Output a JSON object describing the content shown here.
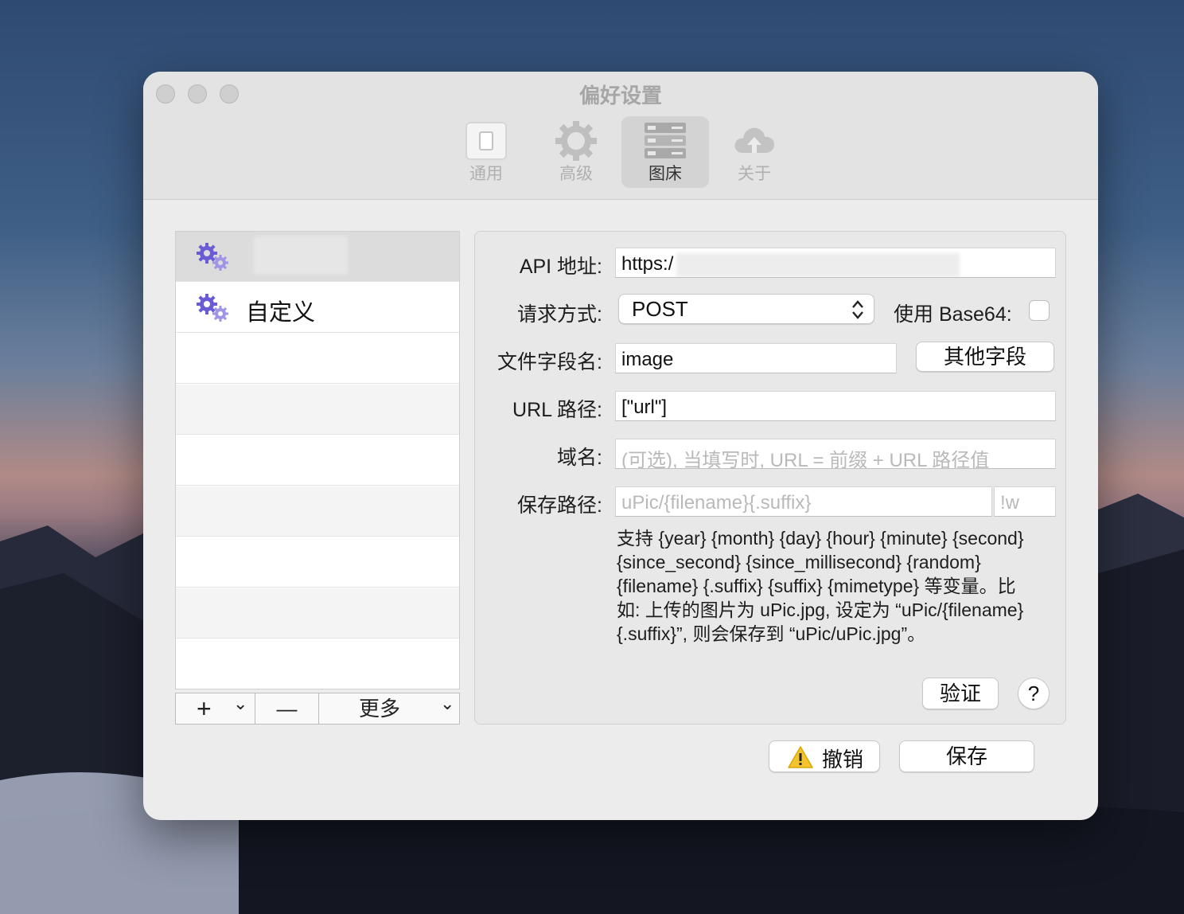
{
  "window": {
    "title": "偏好设置"
  },
  "tabs": [
    {
      "label": "通用",
      "icon": "switch-icon"
    },
    {
      "label": "高级",
      "icon": "gear-icon"
    },
    {
      "label": "图床",
      "icon": "server-icon",
      "selected": true
    },
    {
      "label": "关于",
      "icon": "cloud-upload-icon"
    }
  ],
  "hosts": [
    {
      "name": "",
      "icon": "custom-gears-icon",
      "selected": true
    },
    {
      "name": "自定义",
      "icon": "custom-gears-icon"
    }
  ],
  "list_toolbar": {
    "add": "+",
    "add_menu": "⌄",
    "remove": "—",
    "more": "更多",
    "more_menu": "⌄"
  },
  "form": {
    "api_label": "API 地址:",
    "api_value": "https:/",
    "method_label": "请求方式:",
    "method_value": "POST",
    "base64_label": "使用 Base64:",
    "field_label": "文件字段名:",
    "field_value": "image",
    "other_fields_button": "其他字段",
    "url_path_label": "URL 路径:",
    "url_path_value": "[\"url\"]",
    "domain_label": "域名:",
    "domain_placeholder": "(可选), 当填写时, URL = 前缀 + URL 路径值",
    "save_path_label": "保存路径:",
    "save_path_placeholder": "uPic/{filename}{.suffix}",
    "suffix_placeholder": "!w",
    "help_lines": [
      "支持 {year} {month} {day} {hour} {minute} {second}",
      "{since_second} {since_millisecond} {random}",
      "{filename} {.suffix} {suffix} {mimetype} 等变量。比",
      "如: 上传的图片为 uPic.jpg, 设定为 “uPic/{filename}",
      "{.suffix}”, 则会保存到 “uPic/uPic.jpg”。"
    ],
    "verify_button": "验证",
    "help_button": "?"
  },
  "footer": {
    "cancel_button": "撤销",
    "save_button": "保存"
  }
}
